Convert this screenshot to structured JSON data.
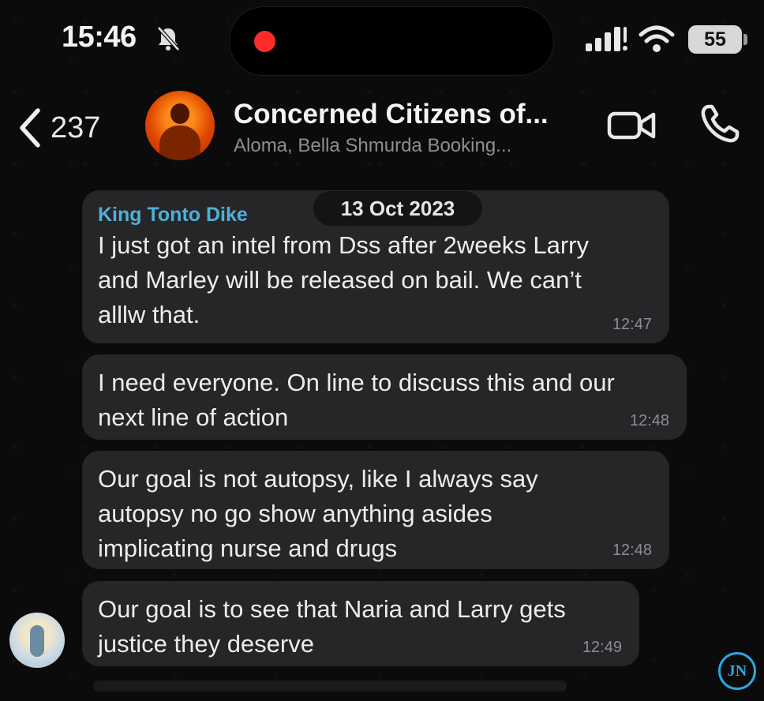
{
  "status_bar": {
    "time": "15:46",
    "battery": "55",
    "icons": [
      "bell-slash-icon",
      "recording-dot-icon",
      "cellular-signal-icon",
      "wifi-icon",
      "battery-icon"
    ]
  },
  "header": {
    "back_count": "237",
    "group_name": "Concerned Citizens of...",
    "members": "Aloma, Bella Shmurda Booking...",
    "icons": [
      "chevron-left-icon",
      "video-camera-icon",
      "phone-icon"
    ]
  },
  "date_divider": "13 Oct 2023",
  "messages": [
    {
      "sender": "King Tonto Dike",
      "lines": [
        "I just got an intel from Dss after 2weeks Larry",
        "and Marley will be released on bail. We can’t",
        "alllw that."
      ],
      "time": "12:47"
    },
    {
      "lines": [
        "I need everyone. On line to discuss this and our",
        "next line of action"
      ],
      "time": "12:48"
    },
    {
      "lines": [
        "Our goal is not autopsy, like I always say",
        "autopsy no go show anything asides",
        "implicating nurse and drugs"
      ],
      "time": "12:48"
    },
    {
      "lines": [
        "Our goal is to see that Naria and Larry gets",
        "justice they deserve"
      ],
      "time": "12:49"
    }
  ],
  "watermark": "JN"
}
